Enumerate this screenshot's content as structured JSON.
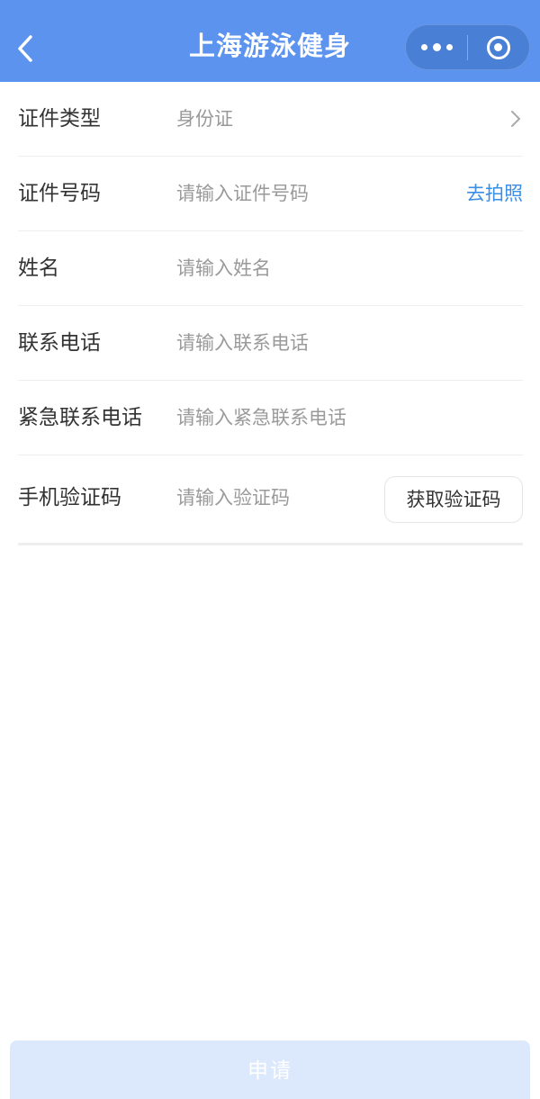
{
  "header": {
    "title": "上海游泳健身",
    "back_icon": "back-arrow-icon",
    "more_icon": "more-dots-icon",
    "close_icon": "miniprogram-close-icon",
    "bg_color": "#5b93ef"
  },
  "form": {
    "id_type": {
      "label": "证件类型",
      "value": "身份证",
      "icon": "chevron-right-icon"
    },
    "id_number": {
      "label": "证件号码",
      "placeholder": "请输入证件号码",
      "action": "去拍照"
    },
    "name": {
      "label": "姓名",
      "placeholder": "请输入姓名"
    },
    "phone": {
      "label": "联系电话",
      "placeholder": "请输入联系电话"
    },
    "emergency_phone": {
      "label": "紧急联系电话",
      "placeholder": "请输入紧急联系电话"
    },
    "sms_code": {
      "label": "手机验证码",
      "placeholder": "请输入验证码",
      "button": "获取验证码"
    }
  },
  "footer": {
    "submit_label": "申请",
    "submit_color": "#dce8fb"
  }
}
